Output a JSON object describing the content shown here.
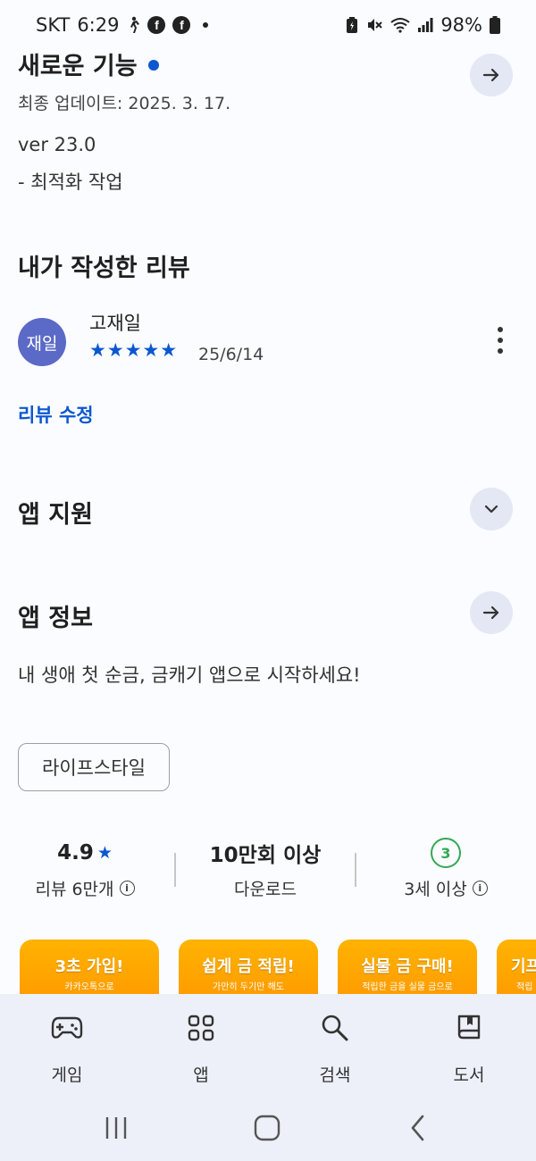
{
  "status_bar": {
    "carrier": "SKT",
    "time": "6:29",
    "battery": "98%",
    "icons": [
      "walking-icon",
      "facebook-icon",
      "facebook-icon",
      "dot-icon",
      "battery-saver-icon",
      "mute-icon",
      "wifi-icon",
      "signal-icon",
      "battery-icon"
    ]
  },
  "whats_new": {
    "title": "새로운 기능",
    "updated": "최종 업데이트: 2025. 3. 17.",
    "version": "ver 23.0",
    "note": "- 최적화 작업"
  },
  "my_review": {
    "title": "내가 작성한 리뷰",
    "avatar_text": "재일",
    "author": "고재일",
    "stars": "★★★★★",
    "rating": 5,
    "date": "25/6/14",
    "edit_label": "리뷰 수정"
  },
  "app_support": {
    "title": "앱 지원"
  },
  "app_info": {
    "title": "앱 정보",
    "description": "내 생애 첫 순금, 금캐기 앱으로 시작하세요!",
    "category_chip": "라이프스타일"
  },
  "stats": {
    "rating": "4.9",
    "rating_star": "★",
    "reviews": "리뷰 6만개",
    "downloads": "10만회 이상",
    "downloads_label": "다운로드",
    "age_badge": "3",
    "age_label": "3세 이상"
  },
  "screenshots": [
    {
      "title": "3초 가입!",
      "sub": "카카오톡으로"
    },
    {
      "title": "쉽게 금 적립!",
      "sub": "가만히 두기만 해도"
    },
    {
      "title": "실물 금 구매!",
      "sub": "적립한 금을 실물 금으로"
    },
    {
      "title": "기프",
      "sub": "적립"
    }
  ],
  "bottom_nav": {
    "items": [
      {
        "label": "게임",
        "icon": "gamepad-icon"
      },
      {
        "label": "앱",
        "icon": "apps-grid-icon"
      },
      {
        "label": "검색",
        "icon": "search-icon"
      },
      {
        "label": "도서",
        "icon": "book-icon"
      }
    ]
  },
  "system_nav": [
    "recents-icon",
    "home-icon",
    "back-icon"
  ],
  "colors": {
    "accent": "#0b57d0",
    "avatar": "#5b6ac6",
    "age_green": "#34a853",
    "nav_bg": "#edf0f8",
    "circle_btn": "#e3e8f4"
  }
}
